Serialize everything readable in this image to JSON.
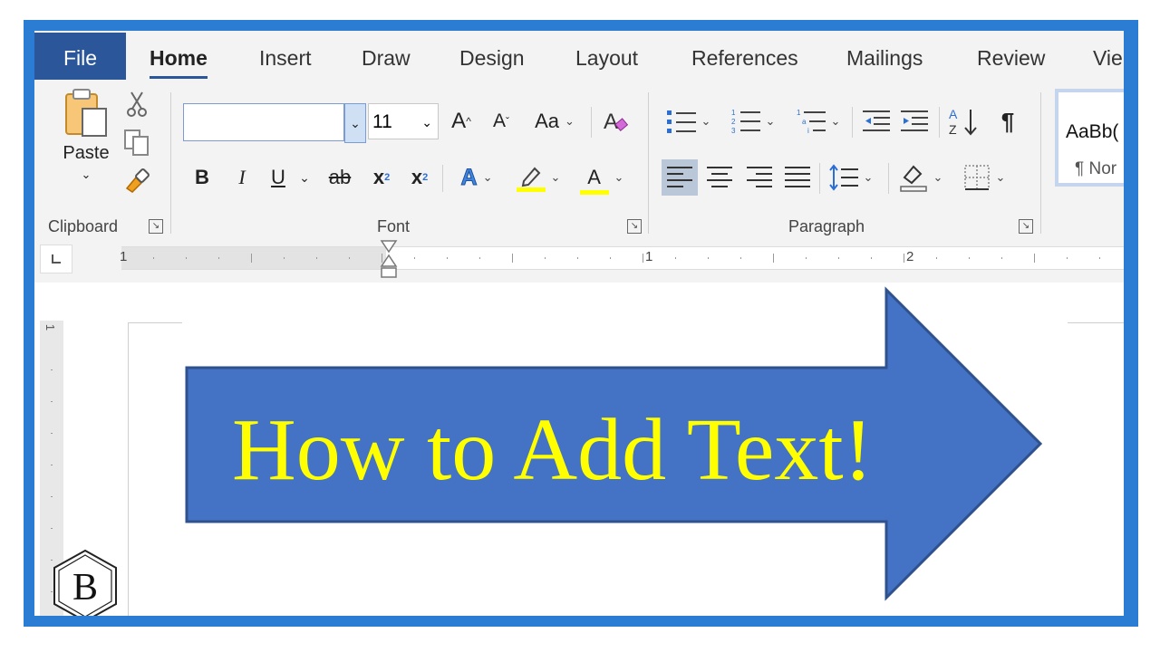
{
  "tabs": [
    "File",
    "Home",
    "Insert",
    "Draw",
    "Design",
    "Layout",
    "References",
    "Mailings",
    "Review",
    "Vie"
  ],
  "clipboard": {
    "paste_label": "Paste",
    "group_label": "Clipboard"
  },
  "font": {
    "font_name": "",
    "font_size": "11",
    "grow_label": "A",
    "shrink_label": "A",
    "change_case_label": "Aa",
    "bold": "B",
    "italic": "I",
    "underline": "U",
    "strikethrough": "ab",
    "subscript": "x",
    "superscript": "x",
    "text_effects": "A",
    "font_color": "A",
    "group_label": "Font"
  },
  "paragraph": {
    "group_label": "Paragraph",
    "pilcrow": "¶"
  },
  "styles": {
    "preview": "AaBb(",
    "name": "¶ Nor"
  },
  "ruler": {
    "numbers": [
      "1",
      "1",
      "2"
    ],
    "vertical_number": "1"
  },
  "document": {
    "arrow_text": "How to Add Text!",
    "arrow_color": "#4472c4",
    "arrow_border": "#2f528f",
    "text_color": "#ffff00"
  },
  "logo": {
    "letter": "B"
  },
  "colors": {
    "frame": "#2b7cd3",
    "file_tab": "#2b579a",
    "highlight": "#ffff00"
  }
}
